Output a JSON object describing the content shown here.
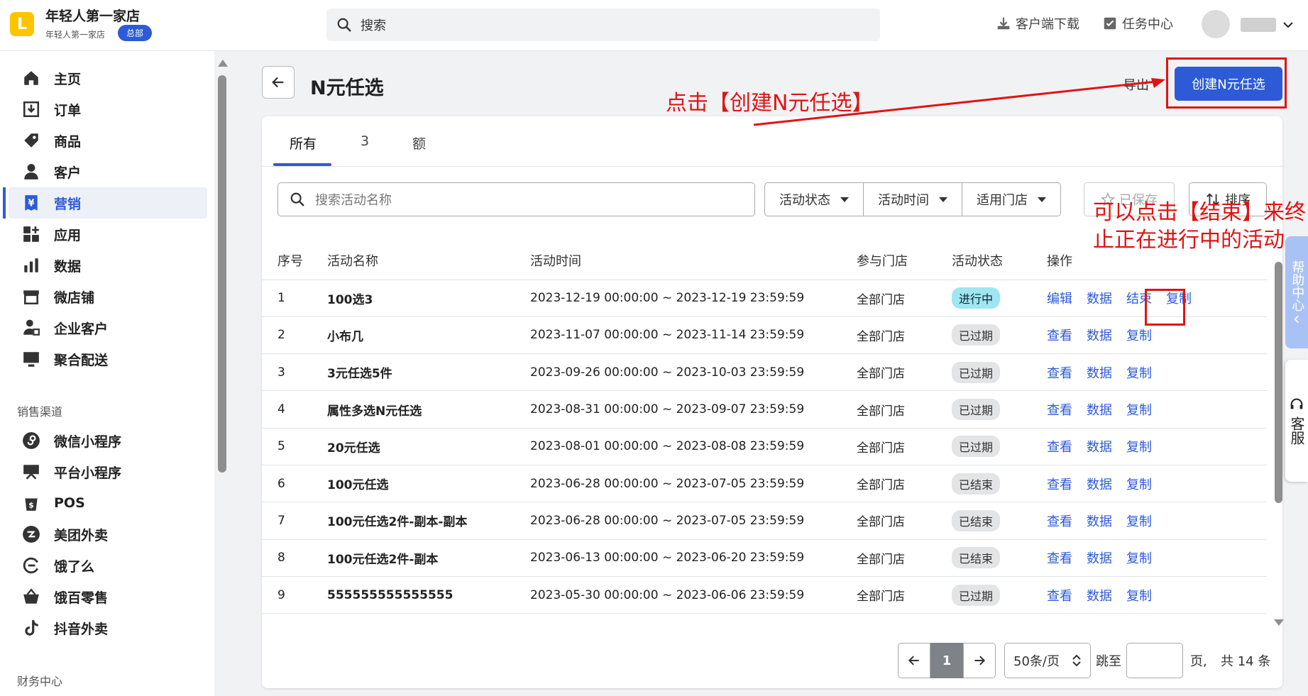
{
  "header": {
    "store_name": "年轻人第一家店",
    "store_sub": "年轻人第一家店",
    "hq_badge": "总部",
    "search_placeholder": "搜索",
    "download_label": "客户端下载",
    "tasks_label": "任务中心"
  },
  "sidebar": {
    "items": [
      {
        "label": "主页",
        "icon": "home-icon"
      },
      {
        "label": "订单",
        "icon": "order-icon"
      },
      {
        "label": "商品",
        "icon": "tag-icon"
      },
      {
        "label": "客户",
        "icon": "person-icon"
      },
      {
        "label": "营销",
        "icon": "yen-icon",
        "active": true
      },
      {
        "label": "应用",
        "icon": "apps-icon"
      },
      {
        "label": "数据",
        "icon": "bar-chart-icon"
      },
      {
        "label": "微店铺",
        "icon": "store-icon"
      },
      {
        "label": "企业客户",
        "icon": "enterprise-user-icon"
      },
      {
        "label": "聚合配送",
        "icon": "monitor-icon"
      }
    ],
    "section_sales": "销售渠道",
    "channels": [
      {
        "label": "微信小程序",
        "icon": "wechat-mini-icon"
      },
      {
        "label": "平台小程序",
        "icon": "platform-mini-icon"
      },
      {
        "label": "POS",
        "icon": "pos-icon"
      },
      {
        "label": "美团外卖",
        "icon": "meituan-icon"
      },
      {
        "label": "饿了么",
        "icon": "eleme-icon"
      },
      {
        "label": "饿百零售",
        "icon": "basket-icon"
      },
      {
        "label": "抖音外卖",
        "icon": "douyin-icon"
      }
    ],
    "section_finance": "财务中心"
  },
  "page": {
    "title": "N元任选",
    "export_label": "导出",
    "create_label": "创建N元任选"
  },
  "tabs": [
    "所有",
    "3",
    "额"
  ],
  "filters": {
    "search_placeholder": "搜索活动名称",
    "status": "活动状态",
    "time": "活动时间",
    "store": "适用门店",
    "saved": "已保存",
    "sort": "排序"
  },
  "table": {
    "columns": [
      "序号",
      "活动名称",
      "活动时间",
      "参与门店",
      "活动状态",
      "操作"
    ],
    "rows": [
      {
        "idx": "1",
        "name": "100选3",
        "time": "2023-12-19 00:00:00 ~ 2023-12-19 23:59:59",
        "store": "全部门店",
        "status": "进行中",
        "ops": [
          "编辑",
          "数据",
          "结束",
          "复制"
        ]
      },
      {
        "idx": "2",
        "name": "小布几",
        "time": "2023-11-07 00:00:00 ~ 2023-11-14 23:59:59",
        "store": "全部门店",
        "status": "已过期",
        "ops": [
          "查看",
          "数据",
          "复制"
        ]
      },
      {
        "idx": "3",
        "name": "3元任选5件",
        "time": "2023-09-26 00:00:00 ~ 2023-10-03 23:59:59",
        "store": "全部门店",
        "status": "已过期",
        "ops": [
          "查看",
          "数据",
          "复制"
        ]
      },
      {
        "idx": "4",
        "name": "属性多选N元任选",
        "time": "2023-08-31 00:00:00 ~ 2023-09-07 23:59:59",
        "store": "全部门店",
        "status": "已过期",
        "ops": [
          "查看",
          "数据",
          "复制"
        ]
      },
      {
        "idx": "5",
        "name": "20元任选",
        "time": "2023-08-01 00:00:00 ~ 2023-08-08 23:59:59",
        "store": "全部门店",
        "status": "已过期",
        "ops": [
          "查看",
          "数据",
          "复制"
        ]
      },
      {
        "idx": "6",
        "name": "100元任选",
        "time": "2023-06-28 00:00:00 ~ 2023-07-05 23:59:59",
        "store": "全部门店",
        "status": "已结束",
        "ops": [
          "查看",
          "数据",
          "复制"
        ]
      },
      {
        "idx": "7",
        "name": "100元任选2件-副本-副本",
        "time": "2023-06-28 00:00:00 ~ 2023-07-05 23:59:59",
        "store": "全部门店",
        "status": "已结束",
        "ops": [
          "查看",
          "数据",
          "复制"
        ]
      },
      {
        "idx": "8",
        "name": "100元任选2件-副本",
        "time": "2023-06-13 00:00:00 ~ 2023-06-20 23:59:59",
        "store": "全部门店",
        "status": "已结束",
        "ops": [
          "查看",
          "数据",
          "复制"
        ]
      },
      {
        "idx": "9",
        "name": "555555555555555",
        "time": "2023-05-30 00:00:00 ~ 2023-06-06 23:59:59",
        "store": "全部门店",
        "status": "已过期",
        "ops": [
          "查看",
          "数据",
          "复制"
        ]
      }
    ]
  },
  "pagination": {
    "current_page": "1",
    "page_size": "50条/页",
    "jump_label": "跳至",
    "page_unit": "页,",
    "total": "共 14 条"
  },
  "annotations": {
    "create_hint": "点击【创建N元任选】",
    "end_hint": "可以点击【结束】来终止正在进行中的活动"
  },
  "floating": {
    "help": "帮助中心",
    "service": "客服"
  },
  "colors": {
    "accent": "#2d5bd7",
    "annotation": "#e01414",
    "running_badge": "#9ee6f2"
  }
}
